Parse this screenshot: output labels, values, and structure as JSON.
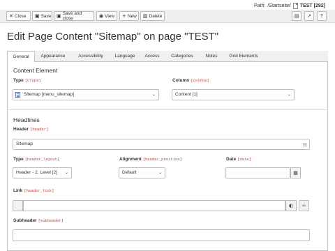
{
  "path": {
    "label": "Path:",
    "value": "/Startseite/",
    "record": "TEST [292]"
  },
  "toolbar": {
    "close": "Close",
    "save": "Save",
    "save_close": "Save and close",
    "view": "View",
    "new": "New",
    "delete": "Delete"
  },
  "page_title": "Edit Page Content \"Sitemap\" on page \"TEST\"",
  "tabs": [
    "General",
    "Appearance",
    "Accessibility",
    "Language",
    "Access",
    "Categories",
    "Notes",
    "Grid Elements"
  ],
  "content_element": {
    "heading": "Content Element",
    "type_label": "Type",
    "type_field": "[CType]",
    "type_value": "Sitemap [menu_sitemap]",
    "column_label": "Column",
    "column_field": "[colPos]",
    "column_value": "Content [1]"
  },
  "headlines": {
    "heading": "Headlines",
    "header_label": "Header",
    "header_field": "[header]",
    "header_value": "Sitemap",
    "type_label": "Type",
    "type_field": "[header_layout]",
    "type_value": "Header - 2. Level [2]",
    "align_label": "Alignment",
    "align_field": "[header_position]",
    "align_value": "Default",
    "date_label": "Date",
    "date_field": "[date]",
    "date_value": "",
    "link_label": "Link",
    "link_field": "[header_link]",
    "link_value": "",
    "subheader_label": "Subheader",
    "subheader_field": "[subheader]",
    "subheader_value": ""
  }
}
